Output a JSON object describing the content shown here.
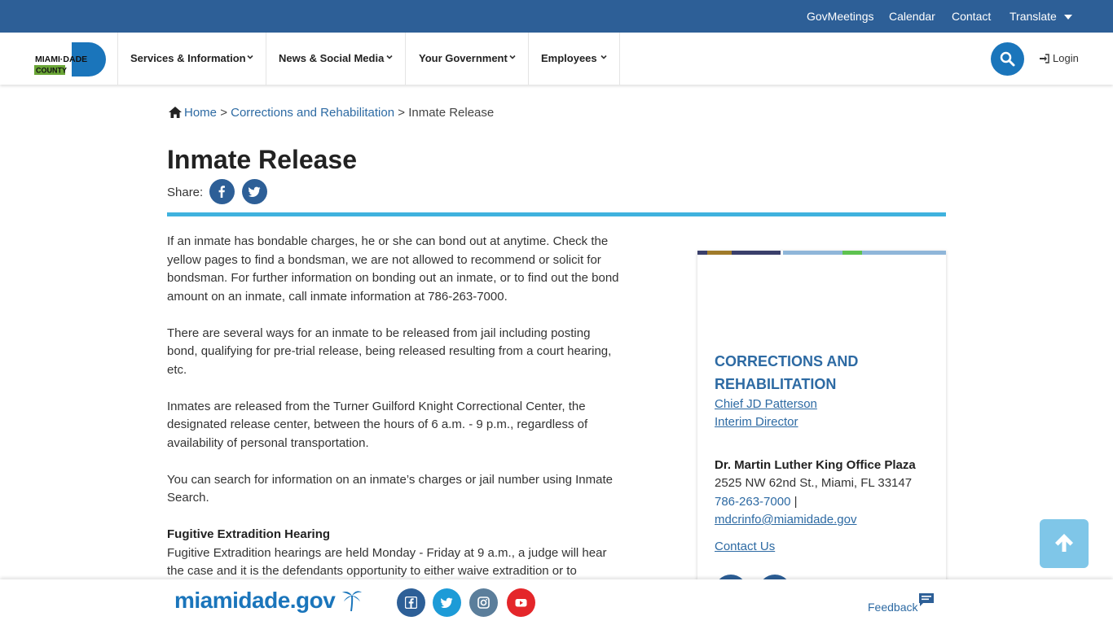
{
  "utility_bar": {
    "links": [
      "GovMeetings",
      "Calendar",
      "Contact",
      "Translate"
    ]
  },
  "logo": {
    "line1": "MIAMI·DADE",
    "line2": "COUNTY"
  },
  "nav": {
    "items": [
      "Services & Information",
      "News & Social Media",
      "Your Government",
      "Employees"
    ],
    "login": "Login"
  },
  "breadcrumb": {
    "home": "Home",
    "sep1": ">",
    "parent": "Corrections and Rehabilitation",
    "sep2": ">",
    "current": "Inmate Release"
  },
  "page": {
    "title": "Inmate Release",
    "share_label": "Share:",
    "paragraphs": [
      "If an inmate has bondable charges, he or she can bond out at anytime. Check the yellow pages to find a bondsman, we are not allowed to recommend or solicit for bondsman. For further information on bonding out an inmate, or to find out the bond amount on an inmate, call inmate information at 786-263-7000.",
      "There are several ways for an inmate to be released from jail including posting bond, qualifying for pre-trial release, being released resulting from a court hearing, etc.",
      "Inmates are released from the Turner Guilford Knight Correctional Center, the designated release center, between the hours of 6 a.m. - 9 p.m., regardless of availability of personal transportation.",
      "You can search for information on an inmate’s charges or jail number using Inmate Search."
    ],
    "subheading": "Fugitive Extradition Hearing",
    "sub_paragraph": "Fugitive Extradition hearings are held Monday - Friday at 9 a.m., a judge will hear the case and it is the defendants opportunity to either waive extradition or to"
  },
  "sidebar": {
    "dept_name": "CORRECTIONS AND REHABILITATION",
    "director_name": "Chief JD Patterson",
    "director_title": "Interim Director",
    "address_title": "Dr. Martin Luther King Office Plaza",
    "address": "2525 NW 62nd St., Miami, FL 33147",
    "phone": "786-263-7000",
    "phone_sep": " |",
    "email": "mdcrinfo@miamidade.gov",
    "contact_link": "Contact Us"
  },
  "footer": {
    "brand": "miamidade.gov",
    "feedback": "Feedback"
  },
  "colors": {
    "primary_blue": "#2d5f97",
    "link_blue": "#2d6aa3",
    "accent_cyan": "#3fb2de",
    "search_blue": "#1a75bb",
    "youtube_red": "#e4262a",
    "instagram_gray": "#5b7e9b",
    "logo_green": "#6aa536"
  },
  "icons": {
    "home": "home-icon",
    "search": "search-icon",
    "login": "sign-in-icon",
    "facebook": "facebook-icon",
    "twitter": "twitter-icon",
    "instagram": "instagram-icon",
    "youtube": "youtube-icon",
    "back_to_top": "arrow-up-icon",
    "feedback": "comment-icon"
  }
}
